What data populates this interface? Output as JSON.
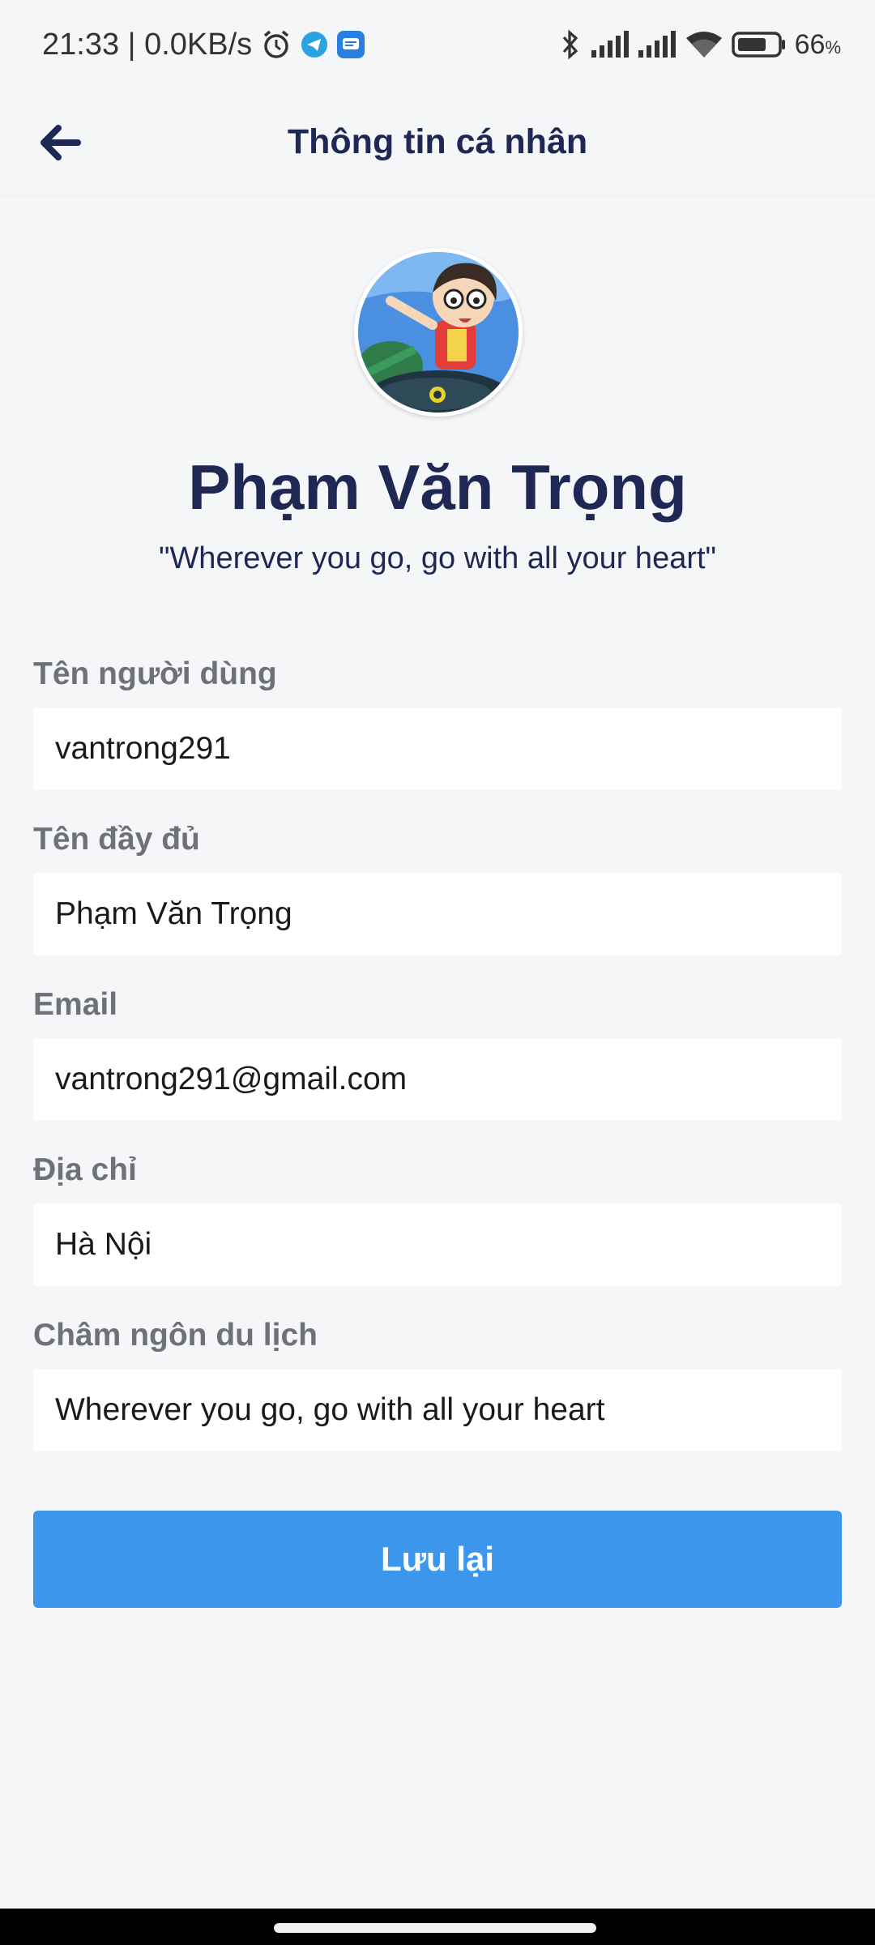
{
  "status_bar": {
    "time_speed": "21:33 | 0.0KB/s",
    "battery_pct": "66",
    "battery_unit": "%",
    "battery_level": 0.66,
    "icons": [
      "alarm-icon",
      "telegram-icon",
      "message-icon",
      "bluetooth-icon",
      "signal-icon",
      "signal-icon",
      "wifi-icon",
      "battery-icon"
    ]
  },
  "header": {
    "title": "Thông tin cá nhân",
    "back_icon": "arrow-left-icon"
  },
  "profile": {
    "name": "Phạm Văn Trọng",
    "quote": "\"Wherever you go, go with all your heart\""
  },
  "form": {
    "username": {
      "label": "Tên người dùng",
      "value": "vantrong291"
    },
    "fullname": {
      "label": "Tên đầy đủ",
      "value": "Phạm Văn Trọng"
    },
    "email": {
      "label": "Email",
      "value": "vantrong291@gmail.com"
    },
    "address": {
      "label": "Địa chỉ",
      "value": "Hà Nội"
    },
    "motto": {
      "label": "Châm ngôn du lịch",
      "value": "Wherever you go, go with all your heart"
    }
  },
  "actions": {
    "save_label": "Lưu lại"
  },
  "colors": {
    "primary": "#3b96ec",
    "title": "#1f2754",
    "label": "#6f7178",
    "background": "#f5f6f8"
  }
}
